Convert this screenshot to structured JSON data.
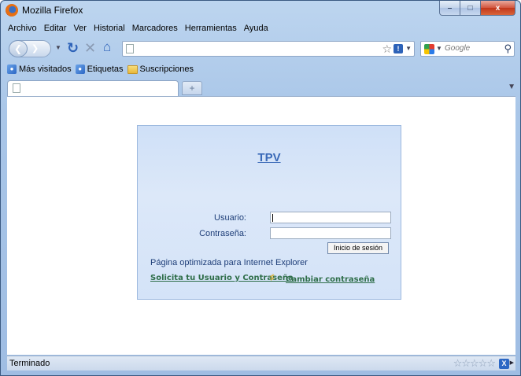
{
  "window": {
    "title": "Mozilla Firefox",
    "controls": {
      "minimize": "–",
      "maximize": "□",
      "close": "x"
    }
  },
  "menubar": {
    "items": [
      "Archivo",
      "Editar",
      "Ver",
      "Historial",
      "Marcadores",
      "Herramientas",
      "Ayuda"
    ]
  },
  "navbar": {
    "url": "",
    "search_placeholder": "Google"
  },
  "bookmarks": {
    "items": [
      {
        "label": "Más visitados",
        "icon": "bookmark-globe-icon"
      },
      {
        "label": "Etiquetas",
        "icon": "bookmark-globe-icon"
      },
      {
        "label": "Suscripciones",
        "icon": "folder-icon"
      }
    ]
  },
  "tabs": {
    "items": [
      {
        "label": ""
      }
    ],
    "new_tab_symbol": "+"
  },
  "login": {
    "title": "TPV",
    "user_label": "Usuario:",
    "user_value": "",
    "password_label": "Contraseña:",
    "password_value": "",
    "submit_label": "Inicio de sesión",
    "optimized_text": "Página optimizada para Internet Explorer",
    "request_link": "Solicita tu Usuario y Contraseña",
    "change_link": "Cambiar contraseña"
  },
  "statusbar": {
    "text": "Terminado",
    "rating_stars": "☆☆☆☆☆"
  },
  "colors": {
    "frame": "#a9c6e8",
    "login_box": "#d4e3f8",
    "title_link": "#3a6ab8",
    "label_text": "#1e3e78",
    "link_green": "#2f6e4a",
    "close_button": "#c1361b"
  }
}
